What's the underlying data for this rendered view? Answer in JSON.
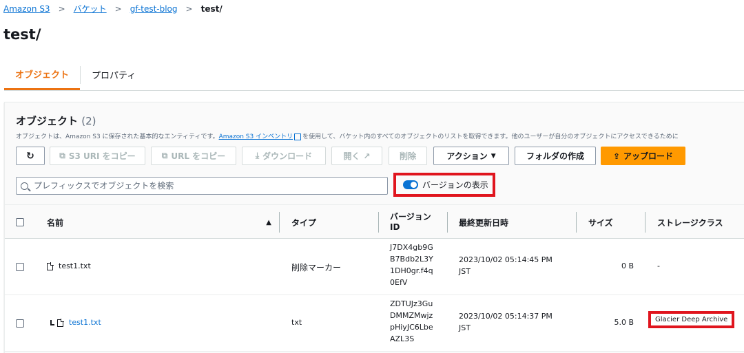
{
  "breadcrumb": [
    "Amazon S3",
    "バケット",
    "gf-test-blog",
    "test/"
  ],
  "page_title": "test/",
  "tabs": [
    "オブジェクト",
    "プロパティ"
  ],
  "panel": {
    "title": "オブジェクト",
    "count": "(2)",
    "desc_pre": "オブジェクトは、Amazon S3 に保存された基本的なエンティティです。",
    "desc_link": "Amazon S3 インベントリ",
    "desc_post": "を使用して、バケット内のすべてのオブジェクトのリストを取得できます。他のユーザーが自分のオブジェクトにアクセスできるために"
  },
  "toolbar": {
    "refresh": "↻",
    "copy_s3_uri": "S3 URI をコピー",
    "copy_url": "URL をコピー",
    "download": "ダウンロード",
    "open": "開く",
    "delete": "削除",
    "actions": "アクション",
    "create_folder": "フォルダの作成",
    "upload": "アップロード"
  },
  "search": {
    "placeholder": "プレフィックスでオブジェクトを検索"
  },
  "version_toggle": {
    "label": "バージョンの表示",
    "on": true
  },
  "columns": {
    "name": "名前",
    "type": "タイプ",
    "version_id_1": "バージョン",
    "version_id_2": "ID",
    "modified": "最終更新日時",
    "size": "サイズ",
    "storage_class": "ストレージクラス"
  },
  "rows": [
    {
      "name": "test1.txt",
      "type": "削除マーカー",
      "version_id": [
        "J7DX4gb9G",
        "B7Bdb2L3Y",
        "1DH0gr.f4q",
        "0EfV"
      ],
      "modified": [
        "2023/10/02 05:14:45 PM",
        "JST"
      ],
      "size": "0 B",
      "storage_class": "-"
    },
    {
      "name": "test1.txt",
      "type": "txt",
      "version_id": [
        "ZDTUJz3Gu",
        "DMMZMwjz",
        "pHiyJC6Lbe",
        "AZL3S"
      ],
      "modified": [
        "2023/10/02 05:14:37 PM",
        "JST"
      ],
      "size": "5.0 B",
      "storage_class": "Glacier Deep Archive"
    }
  ],
  "colors": {
    "accent": "#ec7211",
    "link": "#0972d3",
    "highlight": "#e0151e",
    "primary_button": "#ff9900"
  }
}
